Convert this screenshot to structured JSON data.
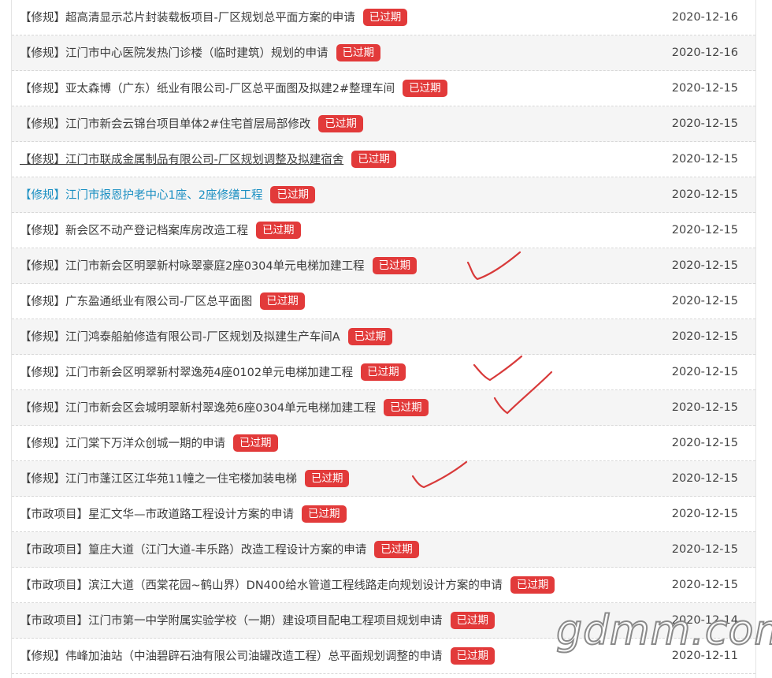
{
  "colors": {
    "badge": "#e23a3a",
    "hover_link": "#1a8fc2",
    "check_mark": "#d83a3a"
  },
  "badge_label": "已过期",
  "watermark": "gdmm.com",
  "rows": [
    {
      "category": "【修规】",
      "title": "超高清显示芯片封装载板项目-厂区规划总平面方案的申请",
      "date": "2020-12-16"
    },
    {
      "category": "【修规】",
      "title": "江门市中心医院发热门诊楼（临时建筑）规划的申请",
      "date": "2020-12-16"
    },
    {
      "category": "【修规】",
      "title": "亚太森博（广东）纸业有限公司-厂区总平面图及拟建2#整理车间",
      "date": "2020-12-15"
    },
    {
      "category": "【修规】",
      "title": "江门市新会云锦台项目单体2#住宅首层局部修改",
      "date": "2020-12-15"
    },
    {
      "category": "【修规】",
      "title": "江门市联成金属制品有限公司-厂区规划调整及拟建宿舍",
      "date": "2020-12-15"
    },
    {
      "category": "【修规】",
      "title": "江门市报恩护老中心1座、2座修缮工程",
      "date": "2020-12-15"
    },
    {
      "category": "【修规】",
      "title": "新会区不动产登记档案库房改造工程",
      "date": "2020-12-15"
    },
    {
      "category": "【修规】",
      "title": "江门市新会区明翠新村咏翠豪庭2座0304单元电梯加建工程",
      "date": "2020-12-15"
    },
    {
      "category": "【修规】",
      "title": "广东盈通纸业有限公司-厂区总平面图",
      "date": "2020-12-15"
    },
    {
      "category": "【修规】",
      "title": "江门鸿泰船舶修造有限公司-厂区规划及拟建生产车间A",
      "date": "2020-12-15"
    },
    {
      "category": "【修规】",
      "title": "江门市新会区明翠新村翠逸苑4座0102单元电梯加建工程",
      "date": "2020-12-15"
    },
    {
      "category": "【修规】",
      "title": "江门市新会区会城明翠新村翠逸苑6座0304单元电梯加建工程",
      "date": "2020-12-15"
    },
    {
      "category": "【修规】",
      "title": "江门棠下万洋众创城一期的申请",
      "date": "2020-12-15"
    },
    {
      "category": "【修规】",
      "title": "江门市蓬江区江华苑11幢之一住宅楼加装电梯",
      "date": "2020-12-15"
    },
    {
      "category": "【市政项目】",
      "title": "星汇文华—市政道路工程设计方案的申请",
      "date": "2020-12-15"
    },
    {
      "category": "【市政项目】",
      "title": "篁庄大道（江门大道-丰乐路）改造工程设计方案的申请",
      "date": "2020-12-15"
    },
    {
      "category": "【市政项目】",
      "title": "滨江大道（西棠花园~鹤山界）DN400给水管道工程线路走向规划设计方案的申请",
      "date": "2020-12-15"
    },
    {
      "category": "【市政项目】",
      "title": "江门市第一中学附属实验学校（一期）建设项目配电工程项目规划申请",
      "date": "2020-12-14"
    },
    {
      "category": "【修规】",
      "title": "伟峰加油站（中油碧辟石油有限公司油罐改造工程）总平面规划调整的申请",
      "date": "2020-12-11"
    }
  ]
}
